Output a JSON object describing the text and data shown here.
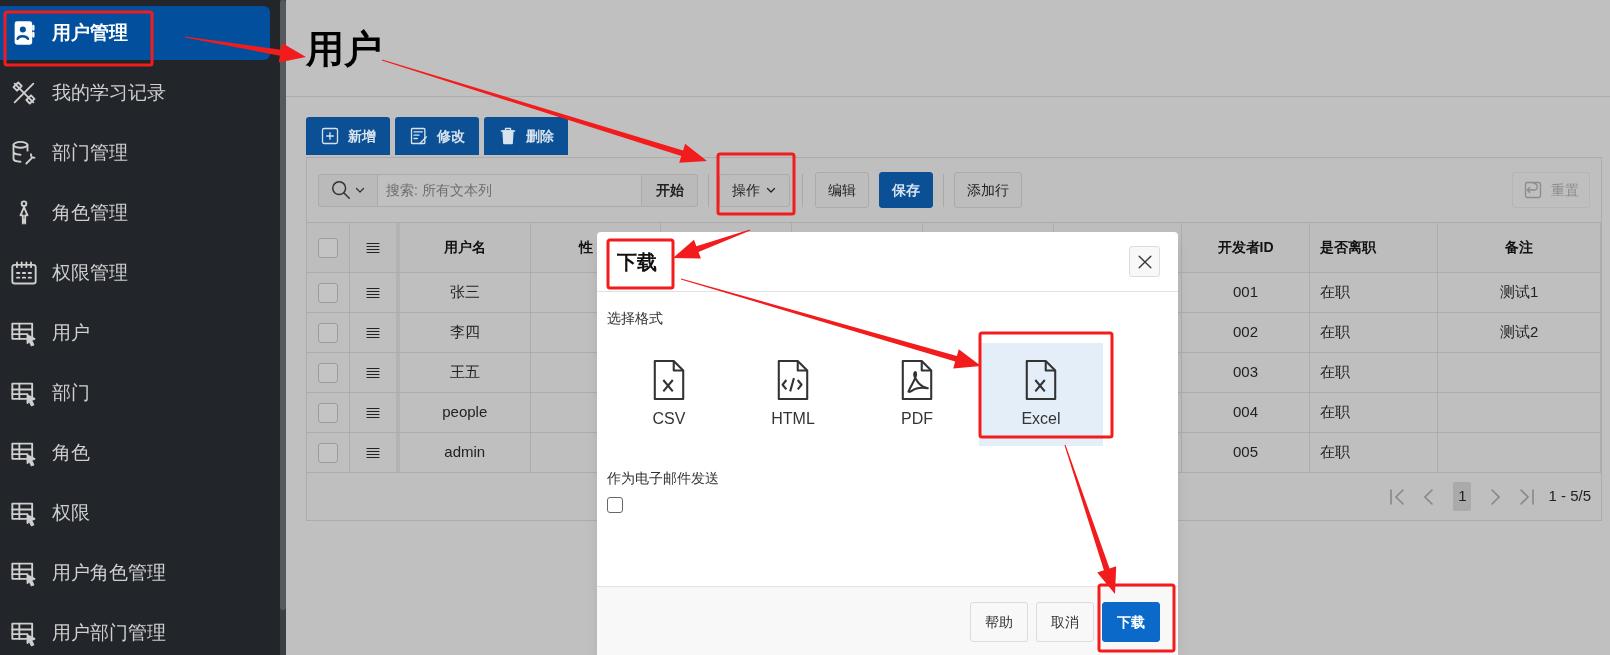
{
  "sidebar": {
    "items": [
      {
        "label": "用户管理",
        "selected": true
      },
      {
        "label": "我的学习记录",
        "selected": false
      },
      {
        "label": "部门管理",
        "selected": false
      },
      {
        "label": "角色管理",
        "selected": false
      },
      {
        "label": "权限管理",
        "selected": false
      },
      {
        "label": "用户",
        "selected": false
      },
      {
        "label": "部门",
        "selected": false
      },
      {
        "label": "角色",
        "selected": false
      },
      {
        "label": "权限",
        "selected": false
      },
      {
        "label": "用户角色管理",
        "selected": false
      },
      {
        "label": "用户部门管理",
        "selected": false
      }
    ]
  },
  "page_title": "用户",
  "actions": [
    "新增",
    "修改",
    "删除"
  ],
  "toolbar": {
    "search_placeholder": "搜索: 所有文本列",
    "go": "开始",
    "menu": "操作",
    "buttons": [
      {
        "label": "编辑",
        "primary": false
      },
      {
        "label": "保存",
        "primary": true
      },
      {
        "label": "添加行",
        "primary": false
      }
    ],
    "reset": "重置"
  },
  "table": {
    "header_checked": false,
    "columns": [
      "用户名",
      "性",
      "开发者ID",
      "是否离职",
      "备注"
    ],
    "rows": [
      {
        "checked": false,
        "cells": [
          "张三",
          "",
          "001",
          "在职",
          "测试1"
        ]
      },
      {
        "checked": false,
        "cells": [
          "李四",
          "",
          "002",
          "在职",
          "测试2"
        ]
      },
      {
        "checked": false,
        "cells": [
          "王五",
          "",
          "003",
          "在职"
        ]
      },
      {
        "checked": false,
        "cells": [
          "people",
          "",
          "004",
          "在职"
        ]
      },
      {
        "checked": false,
        "cells": [
          "admin",
          "",
          "005",
          "在职"
        ]
      }
    ]
  },
  "pagination": {
    "page": "1",
    "range": "1 - 5/5"
  },
  "dialog": {
    "title": "下载",
    "section_label": "选择格式",
    "formats": [
      {
        "label": "CSV",
        "selected": false
      },
      {
        "label": "HTML",
        "selected": false
      },
      {
        "label": "PDF",
        "selected": false
      },
      {
        "label": "Excel",
        "selected": true
      }
    ],
    "email": {
      "label": "作为电子邮件发送",
      "checked": false
    },
    "buttons": [
      {
        "label": "帮助",
        "primary": false
      },
      {
        "label": "取消",
        "primary": false
      },
      {
        "label": "下载",
        "primary": true
      }
    ]
  }
}
